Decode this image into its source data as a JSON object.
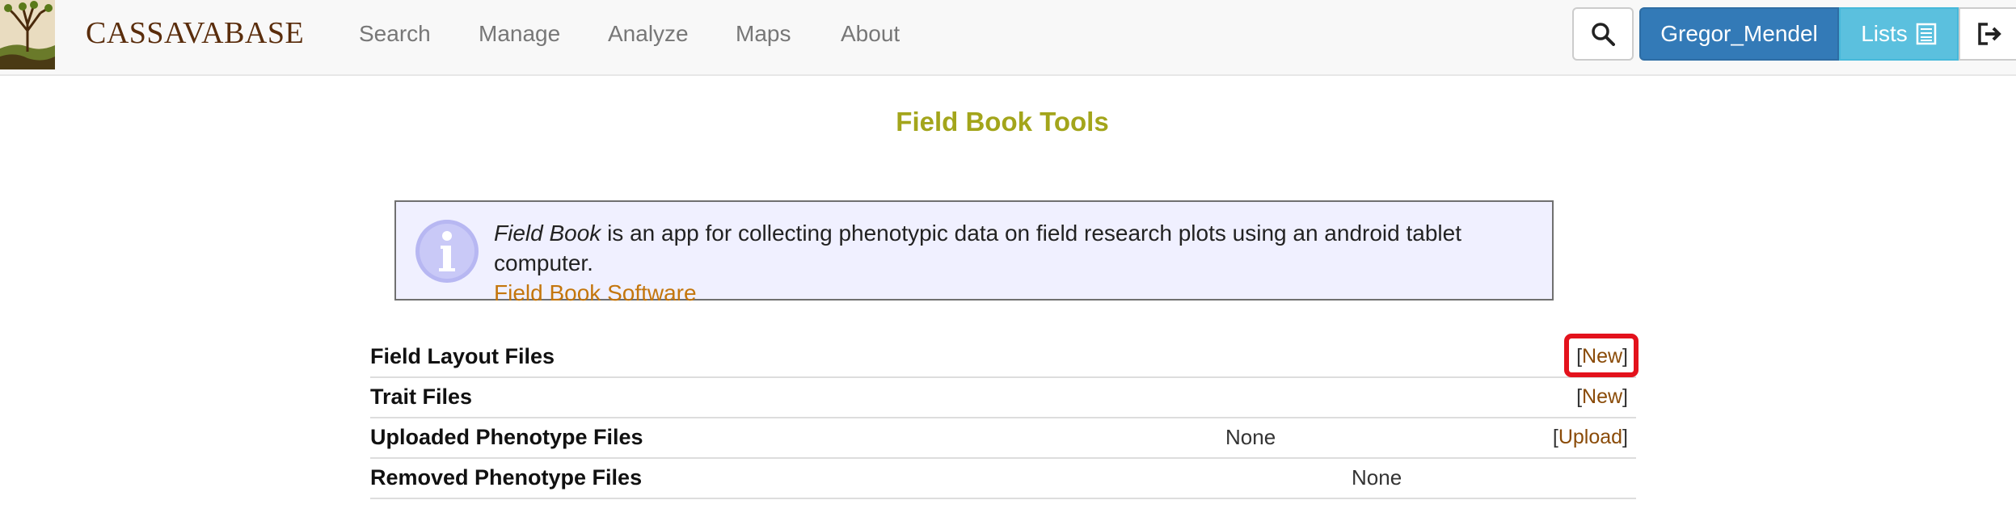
{
  "navbar": {
    "brand": "CASSAVABASE",
    "menu": [
      {
        "label": "Search"
      },
      {
        "label": "Manage"
      },
      {
        "label": "Analyze"
      },
      {
        "label": "Maps"
      },
      {
        "label": "About"
      }
    ],
    "user_label": "Gregor_Mendel",
    "lists_label": "Lists",
    "icons": {
      "search": "search-icon",
      "lists": "list-icon",
      "logout": "logout-icon"
    },
    "colors": {
      "user_button": "#337ab7",
      "lists_button": "#5bc0de",
      "brand": "#5a2d0c"
    }
  },
  "page": {
    "title": "Field Book Tools",
    "title_color": "#a3a51b"
  },
  "info": {
    "app_name": "Field Book",
    "description": " is an app for collecting phenotypic data on field research plots using an android tablet computer.",
    "link_label": "Field Book Software",
    "icon": "info-icon"
  },
  "sections": [
    {
      "title": "Field Layout Files",
      "middle": "",
      "action": "New"
    },
    {
      "title": "Trait Files",
      "middle": "",
      "action": "New"
    },
    {
      "title": "Uploaded Phenotype Files",
      "middle": "None",
      "action": "Upload"
    },
    {
      "title": "Removed Phenotype Files",
      "middle": "None",
      "action": ""
    }
  ],
  "bracket_open": "[",
  "bracket_close": "]",
  "highlight_color": "#e3121c"
}
